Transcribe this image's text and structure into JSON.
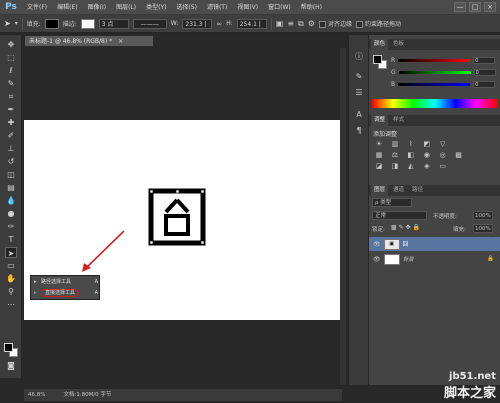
{
  "app": {
    "logo": "Ps"
  },
  "menu": [
    "文件(F)",
    "编辑(E)",
    "图像(I)",
    "图层(L)",
    "类型(Y)",
    "选择(S)",
    "滤镜(T)",
    "视图(V)",
    "窗口(W)",
    "帮助(H)"
  ],
  "window_controls": [
    "—",
    "□",
    "×"
  ],
  "options": {
    "fill_label": "填充:",
    "stroke_label": "描边:",
    "stroke_width": "3 点",
    "w_label": "W:",
    "w_value": "231.3 |",
    "h_label": "H:",
    "h_value": "254.1 |",
    "align_edges": "对齐边缘",
    "constrain_path": "约束路径拖动"
  },
  "document": {
    "tab": "未标题-1 @ 46.8% (RGB/8) *",
    "close": "×"
  },
  "tool_flyout": {
    "items": [
      {
        "label": "路径选择工具",
        "shortcut": "A"
      },
      {
        "label": "直接选择工具",
        "shortcut": "A"
      }
    ]
  },
  "status": {
    "zoom": "46.8%",
    "doc_info": "文档:1.80M/0 字节"
  },
  "color_panel": {
    "tabs": [
      "颜色",
      "色板"
    ],
    "sliders": [
      {
        "name": "R",
        "value": "0",
        "color": "#e03030"
      },
      {
        "name": "G",
        "value": "0",
        "color": "#30c030"
      },
      {
        "name": "B",
        "value": "0",
        "color": "#3050e0"
      }
    ]
  },
  "adjust_panel": {
    "tabs": [
      "调整",
      "样式"
    ],
    "title": "添加调整"
  },
  "layers_panel": {
    "tabs": [
      "图层",
      "通道",
      "路径"
    ],
    "filter": "ρ 类型",
    "blend_mode": "正常",
    "opacity_label": "不透明度:",
    "opacity": "100%",
    "lock_label": "锁定:",
    "fill_label": "填充:",
    "fill": "100%",
    "layers": [
      {
        "name": "回",
        "selected": true
      },
      {
        "name": "背景",
        "selected": false
      }
    ]
  },
  "watermark": {
    "site": "jb51.net",
    "name": "脚本之家"
  }
}
